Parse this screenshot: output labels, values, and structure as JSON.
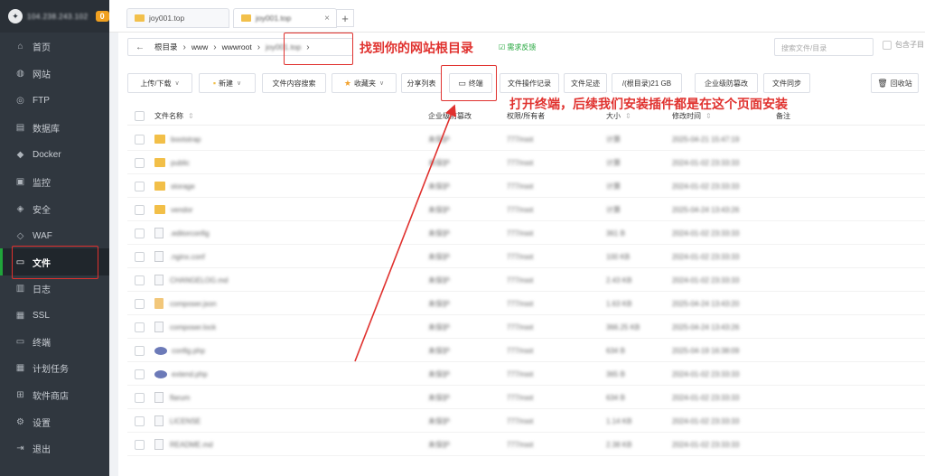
{
  "sidebar": {
    "server_ip": "104.238.243.102",
    "badge": "0",
    "items": [
      {
        "label": "首页",
        "icon": "home-icon"
      },
      {
        "label": "网站",
        "icon": "globe-icon"
      },
      {
        "label": "FTP",
        "icon": "ftp-icon"
      },
      {
        "label": "数据库",
        "icon": "database-icon"
      },
      {
        "label": "Docker",
        "icon": "docker-icon"
      },
      {
        "label": "监控",
        "icon": "monitor-icon"
      },
      {
        "label": "安全",
        "icon": "shield-icon"
      },
      {
        "label": "WAF",
        "icon": "waf-icon"
      },
      {
        "label": "文件",
        "icon": "folder-icon",
        "active": true
      },
      {
        "label": "日志",
        "icon": "log-icon"
      },
      {
        "label": "SSL",
        "icon": "ssl-icon"
      },
      {
        "label": "终端",
        "icon": "terminal-icon"
      },
      {
        "label": "计划任务",
        "icon": "schedule-icon"
      },
      {
        "label": "软件商店",
        "icon": "store-icon"
      },
      {
        "label": "设置",
        "icon": "gear-icon"
      },
      {
        "label": "退出",
        "icon": "logout-icon"
      }
    ]
  },
  "tabs": [
    {
      "label": "joy001.top"
    },
    {
      "label": "joy001.top",
      "active": true
    }
  ],
  "path": {
    "segments": [
      "根目录",
      "www",
      "wwwroot",
      "joy001.top"
    ],
    "feedback": "需求反馈"
  },
  "search": {
    "placeholder": "搜索文件/目录",
    "include_sub": "包含子目"
  },
  "toolbar": {
    "upload": "上传/下载",
    "new": "新建",
    "content_search": "文件内容搜索",
    "favorites": "收藏夹",
    "share_list": "分享列表",
    "terminal": "终端",
    "op_log": "文件操作记录",
    "footprint": "文件足迹",
    "disk": "/(根目录)21 GB",
    "anti_tamper": "企业级防篡改",
    "sync": "文件同步",
    "recycle": "回收站"
  },
  "table": {
    "headers": {
      "name": "文件名称",
      "tamper": "企业级防篡改",
      "perm": "权限/所有者",
      "size": "大小",
      "mtime": "修改时间",
      "note": "备注"
    },
    "rows": [
      {
        "name": "bootstrap",
        "type": "folder",
        "tamper": "未保护",
        "perm": "777/root",
        "size": "计算",
        "mtime": "2025-04-21 15:47:19"
      },
      {
        "name": "public",
        "type": "folder",
        "tamper": "未保护",
        "perm": "777/root",
        "size": "计算",
        "mtime": "2024-01-02 23:33:33"
      },
      {
        "name": "storage",
        "type": "folder",
        "tamper": "未保护",
        "perm": "777/root",
        "size": "计算",
        "mtime": "2024-01-02 23:33:33"
      },
      {
        "name": "vendor",
        "type": "folder",
        "tamper": "未保护",
        "perm": "777/root",
        "size": "计算",
        "mtime": "2025-04-24 13:43:26"
      },
      {
        "name": ".editorconfig",
        "type": "file",
        "tamper": "未保护",
        "perm": "777/root",
        "size": "361 B",
        "mtime": "2024-01-02 23:33:33"
      },
      {
        "name": ".nginx.conf",
        "type": "file",
        "tamper": "未保护",
        "perm": "777/root",
        "size": "100 KB",
        "mtime": "2024-01-02 23:33:33"
      },
      {
        "name": "CHANGELOG.md",
        "type": "file",
        "tamper": "未保护",
        "perm": "777/root",
        "size": "2.43 KB",
        "mtime": "2024-01-02 23:33:33"
      },
      {
        "name": "composer.json",
        "type": "json",
        "tamper": "未保护",
        "perm": "777/root",
        "size": "1.63 KB",
        "mtime": "2025-04-24 13:43:20"
      },
      {
        "name": "composer.lock",
        "type": "file",
        "tamper": "未保护",
        "perm": "777/root",
        "size": "366.25 KB",
        "mtime": "2025-04-24 13:43:26"
      },
      {
        "name": "config.php",
        "type": "php",
        "tamper": "未保护",
        "perm": "777/root",
        "size": "634 B",
        "mtime": "2025-04-19 16:38:09"
      },
      {
        "name": "extend.php",
        "type": "php",
        "tamper": "未保护",
        "perm": "777/root",
        "size": "365 B",
        "mtime": "2024-01-02 23:33:33"
      },
      {
        "name": "flarum",
        "type": "file",
        "tamper": "未保护",
        "perm": "777/root",
        "size": "634 B",
        "mtime": "2024-01-02 23:33:33"
      },
      {
        "name": "LICENSE",
        "type": "file",
        "tamper": "未保护",
        "perm": "777/root",
        "size": "1.14 KB",
        "mtime": "2024-01-02 23:33:33"
      },
      {
        "name": "README.md",
        "type": "file",
        "tamper": "未保护",
        "perm": "777/root",
        "size": "2.38 KB",
        "mtime": "2024-01-02 23:33:33"
      }
    ]
  },
  "annotations": {
    "root_hint": "找到你的网站根目录",
    "terminal_hint": "打开终端，后续我们安装插件都是在这个页面安装",
    "color": "#e0312e"
  }
}
